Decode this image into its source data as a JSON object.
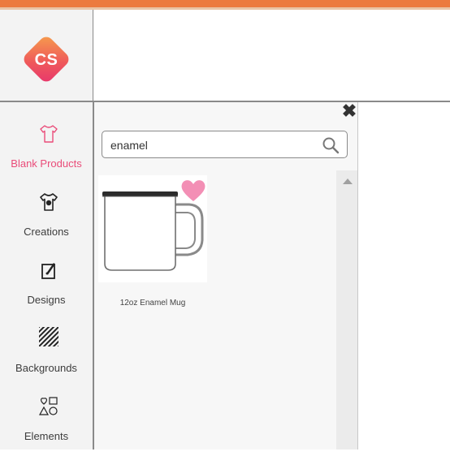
{
  "brand": {
    "logo_text": "CS",
    "logo_colors": [
      "#f6a04c",
      "#e7356e"
    ]
  },
  "colors": {
    "accent_bar": "#ec7a3f",
    "active_nav": "#ea4c79",
    "favorite": "#f38fb5"
  },
  "panel": {
    "close_icon": "close-icon"
  },
  "search": {
    "value": "enamel",
    "icon": "search-icon"
  },
  "sidebar": {
    "items": [
      {
        "label": "Blank Products",
        "icon": "tshirt-outline-icon",
        "active": true
      },
      {
        "label": "Creations",
        "icon": "tshirt-design-icon",
        "active": false
      },
      {
        "label": "Designs",
        "icon": "design-pen-icon",
        "active": false
      },
      {
        "label": "Backgrounds",
        "icon": "pattern-icon",
        "active": false
      },
      {
        "label": "Elements",
        "icon": "shapes-icon",
        "active": false
      }
    ]
  },
  "results": [
    {
      "name": "12oz Enamel Mug",
      "favorited": true,
      "icon": "heart-icon"
    }
  ]
}
